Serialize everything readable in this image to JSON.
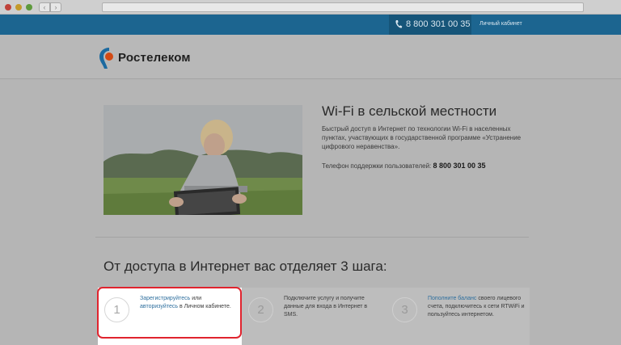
{
  "header": {
    "phone": "8 800 301 00 35",
    "cabinet_link": "Личный кабинет",
    "logo_text": "Ростелеком"
  },
  "hero": {
    "title": "Wi-Fi в сельской местности",
    "description": "Быстрый доступ в Интернет по технологии Wi-Fi в населенных пунктах, участвующих в государственной программе «Устранение цифрового неравенства».",
    "support_label": "Телефон поддержки пользователей:",
    "support_phone": "8 800 301 00 35"
  },
  "steps_title": "От доступа в Интернет вас отделяет 3 шага:",
  "steps": [
    {
      "number": "1",
      "link1": "Зарегистрируйтесь",
      "text1": " или ",
      "link2": "авторизуйтесь",
      "text2": " в Личном кабинете."
    },
    {
      "number": "2",
      "text": "Подключите услугу и получите данные для входа в Интернет в SMS."
    },
    {
      "number": "3",
      "link1": "Пополните баланс",
      "text1": " своего лицевого счета, подключитесь к сети RTWiFi и пользуйтесь интернетом."
    }
  ],
  "colors": {
    "topbar": "#1c6590",
    "highlight_border": "#e0242e",
    "link": "#2e6f9e"
  }
}
